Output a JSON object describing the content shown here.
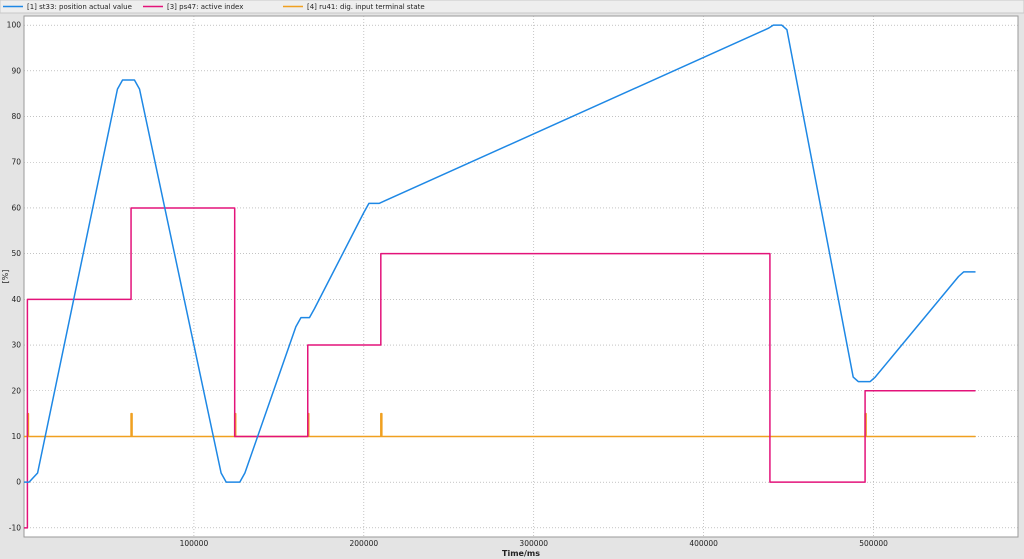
{
  "chart_data": {
    "type": "line",
    "title": "",
    "xlabel": "Time/ms",
    "ylabel": "[%]",
    "xlim": [
      0,
      585000
    ],
    "ylim": [
      -12,
      102
    ],
    "x_ticks": [
      100000,
      200000,
      300000,
      400000,
      500000
    ],
    "x_tick_labels": [
      "100000",
      "200000",
      "300000",
      "400000",
      "500000"
    ],
    "y_ticks": [
      -10,
      0,
      10,
      20,
      30,
      40,
      50,
      60,
      70,
      80,
      90,
      100
    ],
    "y_tick_labels": [
      "-10",
      "0",
      "10",
      "20",
      "30",
      "40",
      "50",
      "60",
      "70",
      "80",
      "90",
      "100"
    ],
    "grid": true,
    "legend_position": "top",
    "series": [
      {
        "name": "[1] st33: position actual value",
        "color": "#1e88e5",
        "x": [
          0,
          3000,
          8000,
          55000,
          58000,
          65000,
          68000,
          116000,
          119000,
          127000,
          130000,
          160000,
          163000,
          168000,
          171000,
          200000,
          203000,
          209000,
          212000,
          438000,
          441000,
          446000,
          449000,
          488000,
          491000,
          498000,
          501000,
          550000,
          553000,
          560000
        ],
        "y": [
          0,
          0,
          2,
          86,
          88,
          88,
          86,
          2,
          0,
          0,
          2,
          34,
          36,
          36,
          38,
          59,
          61,
          61,
          61.5,
          99.3,
          100,
          100,
          99,
          23,
          22,
          22,
          23,
          45,
          46,
          46
        ]
      },
      {
        "name": "[3] ps47: active index",
        "color": "#e3137a",
        "x": [
          0,
          2000,
          2000,
          63000,
          63000,
          124000,
          124000,
          167000,
          167000,
          210000,
          210000,
          439000,
          439000,
          495000,
          495000,
          560000
        ],
        "y": [
          -10,
          -10,
          40,
          40,
          60,
          60,
          10,
          10,
          30,
          30,
          50,
          50,
          0,
          0,
          20,
          20
        ]
      },
      {
        "name": "[4] ru41: dig. input terminal state",
        "color": "#f0a020",
        "x": [
          0,
          2000,
          2000,
          2600,
          2600,
          63000,
          63000,
          63600,
          63600,
          124000,
          124000,
          124600,
          124600,
          167000,
          167000,
          167600,
          167600,
          210000,
          210000,
          210600,
          210600,
          495000,
          495000,
          495600,
          495600,
          560000
        ],
        "y": [
          10,
          10,
          15,
          15,
          10,
          10,
          15,
          15,
          10,
          10,
          15,
          15,
          10,
          10,
          15,
          15,
          10,
          10,
          15,
          15,
          10,
          10,
          15,
          15,
          10,
          10
        ]
      }
    ]
  }
}
